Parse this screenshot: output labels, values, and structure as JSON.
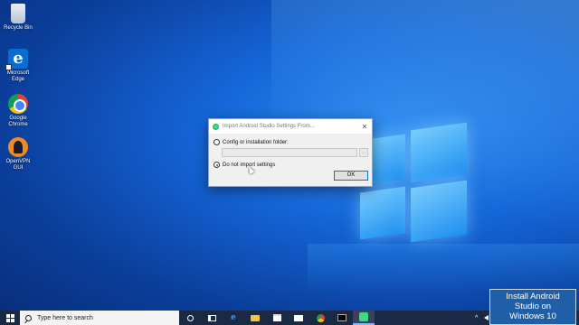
{
  "desktop": {
    "icons": [
      {
        "label": "Recycle Bin",
        "icon": "recycle-bin-icon"
      },
      {
        "label": "Microsoft Edge",
        "icon": "edge-icon"
      },
      {
        "label": "Google Chrome",
        "icon": "chrome-icon"
      },
      {
        "label": "OpenVPN GUI",
        "icon": "openvpn-icon"
      }
    ]
  },
  "dialog": {
    "title": "Import Android Studio Settings From...",
    "option_config": "Config or installation folder:",
    "option_none": "Do not import settings",
    "selected": "Do not import settings",
    "folder_value": "",
    "browse_label": "...",
    "ok_label": "OK",
    "close_glyph": "✕"
  },
  "taskbar": {
    "search_placeholder": "Type here to search",
    "apps": [
      "cortana-icon",
      "task-view-icon",
      "edge-icon",
      "file-explorer-icon",
      "store-icon",
      "mail-icon",
      "chrome-icon",
      "cmd-icon",
      "android-studio-icon"
    ],
    "tray_caret": "^"
  },
  "banner": {
    "line1": "Install Android",
    "line2": "Studio on",
    "line3": "Windows 10"
  },
  "colors": {
    "accent": "#0078d7",
    "android_green": "#3ddc84"
  }
}
